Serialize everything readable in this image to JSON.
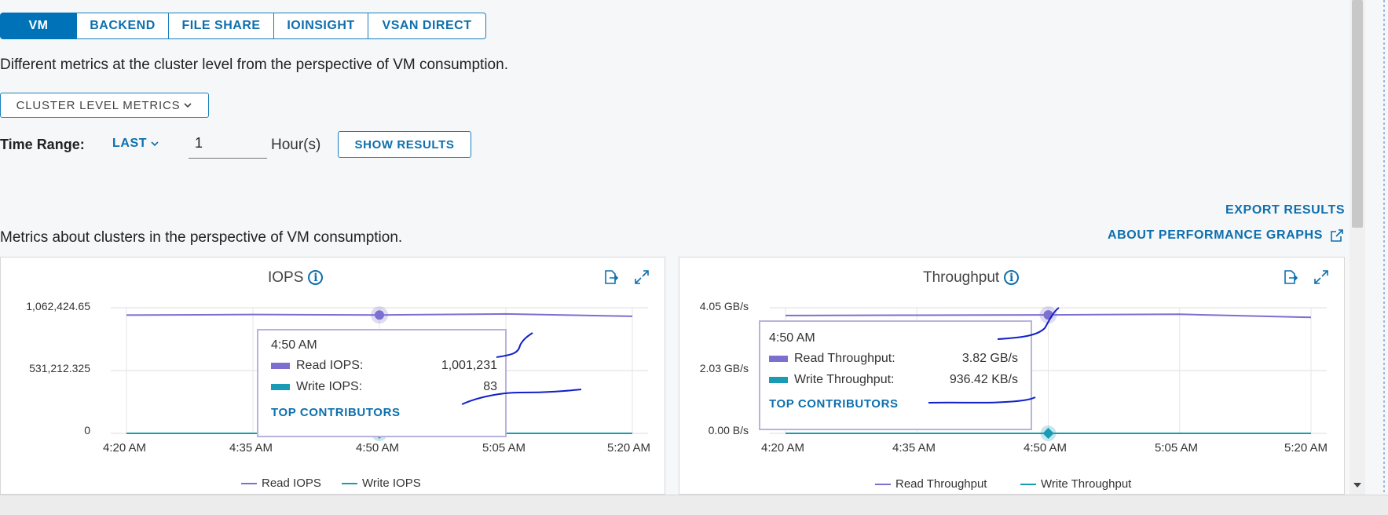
{
  "tabs": [
    {
      "label": "VM",
      "active": true
    },
    {
      "label": "BACKEND",
      "active": false
    },
    {
      "label": "FILE SHARE",
      "active": false
    },
    {
      "label": "IOINSIGHT",
      "active": false
    },
    {
      "label": "VSAN DIRECT",
      "active": false
    }
  ],
  "description": "Different metrics at the cluster level from the perspective of VM consumption.",
  "metrics_dropdown": {
    "label": "CLUSTER LEVEL METRICS"
  },
  "time_range": {
    "label": "Time Range:",
    "mode": "LAST",
    "value": "1",
    "unit": "Hour(s)",
    "show_results": "SHOW RESULTS"
  },
  "export_results": "EXPORT RESULTS",
  "about_graphs": "ABOUT PERFORMANCE GRAPHS",
  "section_text": "Metrics about clusters in the perspective of VM consumption.",
  "colors": {
    "read": "#7b6fd0",
    "write": "#1a9bb5",
    "accent": "#0072b8",
    "annotation": "#1020c8"
  },
  "icons": [
    "info-icon",
    "export-icon",
    "expand-icon",
    "external-link-icon",
    "chevron-down-icon"
  ],
  "chart_data": [
    {
      "type": "line",
      "title": "IOPS",
      "x": [
        "4:20 AM",
        "4:35 AM",
        "4:50 AM",
        "5:05 AM",
        "5:20 AM"
      ],
      "yticks": [
        "1,062,424.65",
        "531,212.325",
        "0"
      ],
      "ylim": [
        0,
        1062424.65
      ],
      "series": [
        {
          "name": "Read IOPS",
          "values": [
            1000000,
            1005000,
            1001231,
            1010000,
            990000
          ]
        },
        {
          "name": "Write IOPS",
          "values": [
            85,
            84,
            83,
            82,
            80
          ]
        }
      ],
      "tooltip": {
        "time": "4:50 AM",
        "rows": [
          {
            "label": "Read IOPS:",
            "value": "1,001,231"
          },
          {
            "label": "Write IOPS:",
            "value": "83"
          }
        ],
        "link": "TOP CONTRIBUTORS"
      },
      "grid": true,
      "legend": "bottom"
    },
    {
      "type": "line",
      "title": "Throughput",
      "x": [
        "4:20 AM",
        "4:35 AM",
        "4:50 AM",
        "5:05 AM",
        "5:20 AM"
      ],
      "yticks": [
        "4.05 GB/s",
        "2.03 GB/s",
        "0.00 B/s"
      ],
      "ylim": [
        0,
        4.05
      ],
      "series": [
        {
          "name": "Read Throughput",
          "values": [
            3.8,
            3.81,
            3.82,
            3.84,
            3.74
          ]
        },
        {
          "name": "Write Throughput",
          "values": [
            0.001,
            0.001,
            0.0009,
            0.001,
            0.001
          ]
        }
      ],
      "tooltip": {
        "time": "4:50 AM",
        "rows": [
          {
            "label": "Read Throughput:",
            "value": "3.82 GB/s"
          },
          {
            "label": "Write Throughput:",
            "value": "936.42 KB/s"
          }
        ],
        "link": "TOP CONTRIBUTORS"
      },
      "grid": true,
      "legend": "bottom"
    }
  ]
}
